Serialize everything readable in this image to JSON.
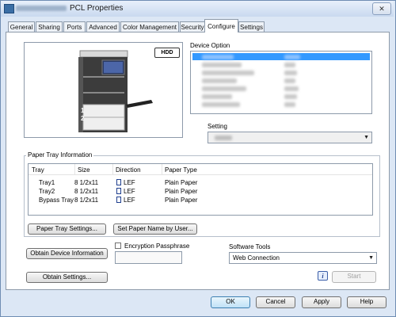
{
  "window": {
    "title": "PCL Properties"
  },
  "tabs": [
    {
      "label": "General"
    },
    {
      "label": "Sharing"
    },
    {
      "label": "Ports"
    },
    {
      "label": "Advanced"
    },
    {
      "label": "Color Management"
    },
    {
      "label": "Security"
    },
    {
      "label": "Configure"
    },
    {
      "label": "Settings"
    }
  ],
  "active_tab": "Configure",
  "printer": {
    "hdd_badge": "HDD",
    "tray_number_1": "1",
    "tray_number_2": "2"
  },
  "device_option": {
    "label": "Device Option"
  },
  "setting": {
    "label": "Setting"
  },
  "paper_tray_info": {
    "label": "Paper Tray Information",
    "columns": [
      "Tray",
      "Size",
      "Direction",
      "Paper Type"
    ],
    "rows": [
      {
        "tray": "Tray1",
        "size": "8 1/2x11",
        "direction": "LEF",
        "paper_type": "Plain Paper"
      },
      {
        "tray": "Tray2",
        "size": "8 1/2x11",
        "direction": "LEF",
        "paper_type": "Plain Paper"
      },
      {
        "tray": "Bypass Tray",
        "size": "8 1/2x11",
        "direction": "LEF",
        "paper_type": "Plain Paper"
      }
    ]
  },
  "buttons": {
    "paper_tray_settings": "Paper Tray Settings...",
    "set_paper_name": "Set Paper Name by User...",
    "obtain_device_info": "Obtain Device Information",
    "obtain_settings": "Obtain Settings...",
    "start": "Start",
    "ok": "OK",
    "cancel": "Cancel",
    "apply": "Apply",
    "help": "Help"
  },
  "encryption": {
    "label": "Encryption Passphrase",
    "checked": false,
    "value": ""
  },
  "software_tools": {
    "label": "Software Tools",
    "selected": "Web Connection"
  },
  "icons": {
    "app": "printer-icon",
    "close": "close-icon",
    "info": "info-icon",
    "dropdown": "chevron-down-icon",
    "paper": "paper-direction-icon"
  },
  "colors": {
    "selection": "#3399ff",
    "panel_border": "#8d9aaa",
    "window_bg": "#dce7f5"
  }
}
